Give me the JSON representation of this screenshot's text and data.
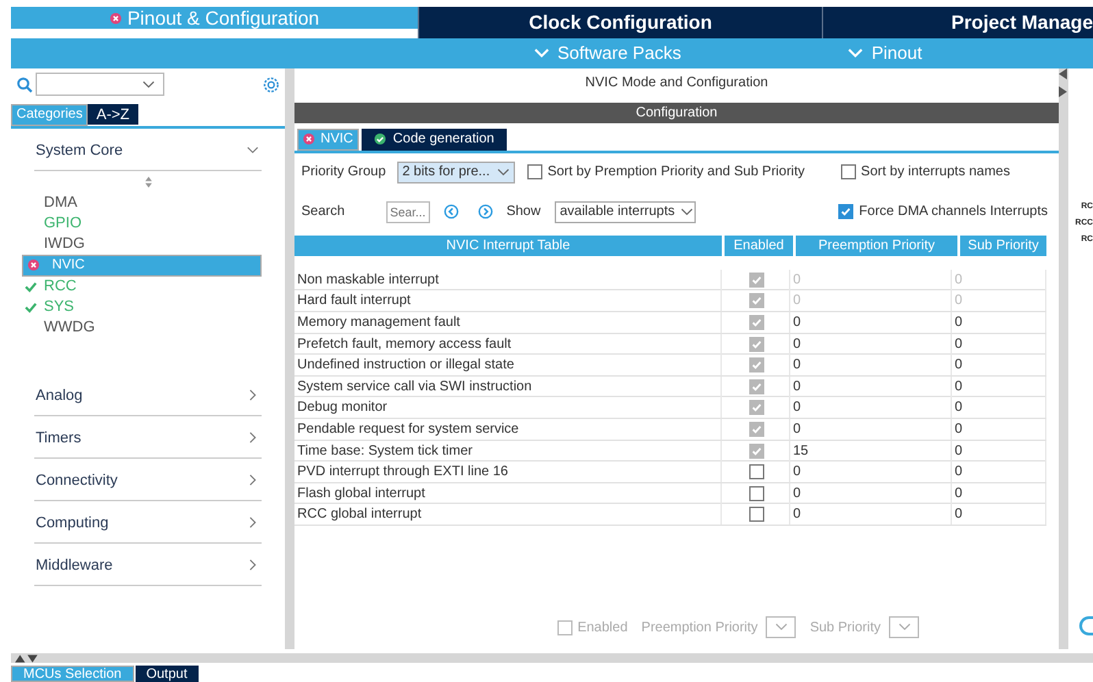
{
  "main_tabs": [
    {
      "label": "Pinout & Configuration",
      "selected": true,
      "kind": "error"
    },
    {
      "label": "Clock Configuration",
      "selected": false,
      "kind": "none"
    },
    {
      "label": "Project Manage",
      "selected": false,
      "kind": "none"
    }
  ],
  "sub_menu": [
    "Software Packs",
    "Pinout"
  ],
  "sidebar": {
    "view_tabs": [
      {
        "label": "Categories",
        "selected": true
      },
      {
        "label": "A->Z",
        "selected": false
      }
    ],
    "categories": [
      {
        "label": "System Core",
        "expanded": true,
        "children": [
          {
            "label": "DMA",
            "kind": "none",
            "selected": false
          },
          {
            "label": "GPIO",
            "kind": "configured",
            "selected": false
          },
          {
            "label": "IWDG",
            "kind": "none",
            "selected": false
          },
          {
            "label": "NVIC",
            "kind": "error",
            "selected": true
          },
          {
            "label": "RCC",
            "kind": "ok",
            "selected": false
          },
          {
            "label": "SYS",
            "kind": "ok",
            "selected": false
          },
          {
            "label": "WWDG",
            "kind": "none",
            "selected": false
          }
        ]
      },
      {
        "label": "Analog",
        "expanded": false
      },
      {
        "label": "Timers",
        "expanded": false
      },
      {
        "label": "Connectivity",
        "expanded": false
      },
      {
        "label": "Computing",
        "expanded": false
      },
      {
        "label": "Middleware",
        "expanded": false
      }
    ]
  },
  "mode_title": "NVIC Mode and Configuration",
  "config_title": "Configuration",
  "config_tabs": [
    {
      "label": "NVIC",
      "selected": true,
      "kind": "error"
    },
    {
      "label": "Code generation",
      "selected": false,
      "kind": "ok"
    }
  ],
  "priority_group": {
    "label": "Priority Group",
    "value": "2 bits for pre..."
  },
  "sort_options": [
    {
      "label": "Sort by Premption Priority and Sub Priority",
      "checked": false
    },
    {
      "label": "Sort by interrupts names",
      "checked": false
    }
  ],
  "search": {
    "label": "Search",
    "placeholder": "Sear..."
  },
  "show": {
    "label": "Show",
    "value": "available interrupts"
  },
  "force_dma": {
    "label": "Force DMA channels Interrupts",
    "checked": true
  },
  "table": {
    "columns": [
      "NVIC Interrupt Table",
      "Enabled",
      "Preemption Priority",
      "Sub Priority"
    ],
    "rows": [
      {
        "name": "Non maskable interrupt",
        "enabled": true,
        "enabled_disabled": true,
        "priority_disabled": true,
        "preemption": "0",
        "sub": "0"
      },
      {
        "name": "Hard fault interrupt",
        "enabled": true,
        "enabled_disabled": true,
        "priority_disabled": true,
        "preemption": "0",
        "sub": "0"
      },
      {
        "name": "Memory management fault",
        "enabled": true,
        "enabled_disabled": true,
        "priority_disabled": false,
        "preemption": "0",
        "sub": "0"
      },
      {
        "name": "Prefetch fault, memory access fault",
        "enabled": true,
        "enabled_disabled": true,
        "priority_disabled": false,
        "preemption": "0",
        "sub": "0"
      },
      {
        "name": "Undefined instruction or illegal state",
        "enabled": true,
        "enabled_disabled": true,
        "priority_disabled": false,
        "preemption": "0",
        "sub": "0"
      },
      {
        "name": "System service call via SWI instruction",
        "enabled": true,
        "enabled_disabled": true,
        "priority_disabled": false,
        "preemption": "0",
        "sub": "0"
      },
      {
        "name": "Debug monitor",
        "enabled": true,
        "enabled_disabled": true,
        "priority_disabled": false,
        "preemption": "0",
        "sub": "0"
      },
      {
        "name": "Pendable request for system service",
        "enabled": true,
        "enabled_disabled": true,
        "priority_disabled": false,
        "preemption": "0",
        "sub": "0"
      },
      {
        "name": "Time base: System tick timer",
        "enabled": true,
        "enabled_disabled": true,
        "priority_disabled": false,
        "preemption": "15",
        "sub": "0"
      },
      {
        "name": "PVD interrupt through EXTI line 16",
        "enabled": false,
        "enabled_disabled": false,
        "priority_disabled": false,
        "preemption": "0",
        "sub": "0"
      },
      {
        "name": "Flash global interrupt",
        "enabled": false,
        "enabled_disabled": false,
        "priority_disabled": false,
        "preemption": "0",
        "sub": "0"
      },
      {
        "name": "RCC global interrupt",
        "enabled": false,
        "enabled_disabled": false,
        "priority_disabled": false,
        "preemption": "0",
        "sub": "0"
      }
    ]
  },
  "footer": {
    "enabled_label": "Enabled",
    "enabled_checked": false,
    "preemption_label": "Preemption Priority",
    "sub_label": "Sub Priority"
  },
  "pin_labels": [
    "RC",
    "RCC",
    "RC"
  ],
  "bottom_tabs": [
    {
      "label": "MCUs Selection",
      "selected": true
    },
    {
      "label": "Output",
      "selected": false
    }
  ]
}
